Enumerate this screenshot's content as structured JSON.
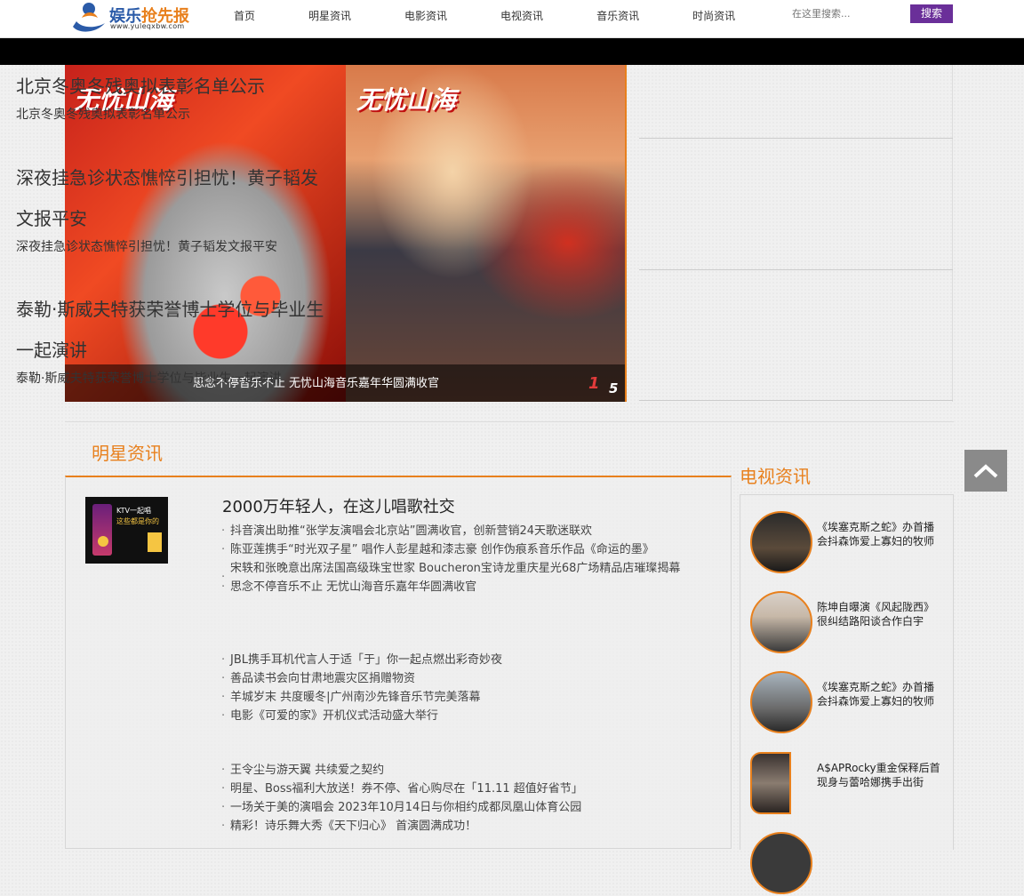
{
  "header": {
    "logo_text_a": "娱乐",
    "logo_text_b": "抢先报",
    "logo_url": "www.yuleqxbw.com",
    "nav": [
      "首页",
      "明星资讯",
      "电影资讯",
      "电视资讯",
      "音乐资讯",
      "时尚资讯"
    ],
    "search_placeholder": "在这里搜索...",
    "search_button": "搜索"
  },
  "slider": {
    "brand_text": "无忧山海",
    "caption": "思念不停音乐不止 无忧山海音乐嘉年华圆满收官",
    "current": "1",
    "total": "5"
  },
  "headlines": [
    {
      "title": "北京冬奥冬残奥拟表彰名单公示",
      "summary": "北京冬奥冬残奥拟表彰名单公示"
    },
    {
      "title_line1": "深夜挂急诊状态憔悴引担忧！黄子韬发",
      "title_line2": "文报平安",
      "summary": "深夜挂急诊状态憔悴引担忧！黄子韬发文报平安"
    },
    {
      "title_line1": "泰勒·斯威夫特获荣誉博士学位与毕业生",
      "title_line2": "一起演讲",
      "summary": "泰勒·斯威夫特获荣誉博士学位与毕业生一起演讲"
    }
  ],
  "stars": {
    "section_title": "明星资讯",
    "thumb_text1": "KTV一起唱",
    "thumb_text2": "这些都是你的",
    "featured_title": "2000万年轻人，在这儿唱歌社交",
    "groups": [
      [
        "抖音演出助推“张学友演唱会北京站”圆满收官，创新营销24天歌迷联欢",
        "陈亚莲携手“时光双子星” 唱作人彭星越和漆志豪 创作伪痕系音乐作品《命运的墨》",
        "宋轶和张晚意出席法国高级珠宝世家 Boucheron宝诗龙重庆星光68广场精品店璀璨揭幕",
        "思念不停音乐不止 无忧山海音乐嘉年华圆满收官"
      ],
      [
        "JBL携手耳机代言人于适「于」你一起点燃出彩奇妙夜",
        "善品读书会向甘肃地震灾区捐赠物资",
        "羊城岁末 共度暖冬|广州南沙先锋音乐节完美落幕",
        "电影《可爱的家》开机仪式活动盛大举行"
      ],
      [
        "王令尘与游天翼 共续爱之契约",
        "明星、Boss福利大放送！券不停、省心购尽在「11.11 超值好省节」",
        "一场关于美的演唱会 2023年10月14日与你相约成都凤凰山体育公园",
        "精彩！诗乐舞大秀《天下归心》 首演圆满成功！"
      ]
    ]
  },
  "tv": {
    "section_title": "电视资讯",
    "items": [
      "《埃塞克斯之蛇》办首播会抖森饰爱上寡妇的牧师",
      "陈坤自曝演《风起陇西》很纠结路阳谈合作白宇",
      "《埃塞克斯之蛇》办首播会抖森饰爱上寡妇的牧师",
      "A$APRocky重金保释后首现身与蕾哈娜携手出街"
    ]
  }
}
